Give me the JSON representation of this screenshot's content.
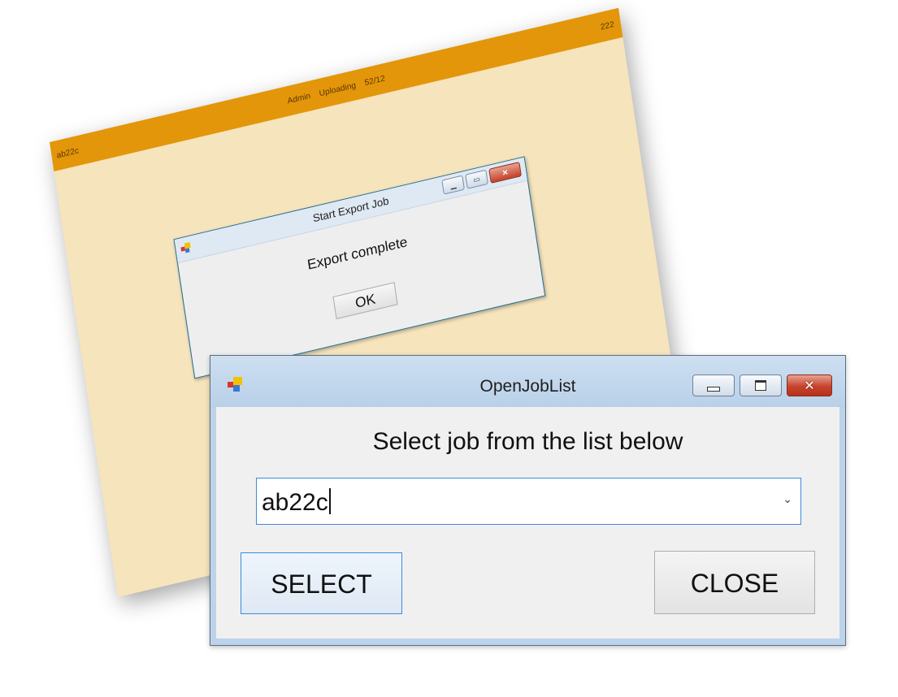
{
  "background_window": {
    "topbar": {
      "left_text": "ab22c",
      "center_items": [
        "Admin",
        "Uploading",
        "52/12"
      ],
      "right_text": "222"
    },
    "dialog": {
      "title": "Start Export Job",
      "message": "Export complete",
      "ok_label": "OK"
    }
  },
  "open_job_list": {
    "title": "OpenJobList",
    "heading": "Select job from the list below",
    "job_combo": {
      "value": "ab22c"
    },
    "select_label": "SELECT",
    "close_label": "CLOSE",
    "window_controls": {
      "close_glyph": "✕"
    }
  },
  "colors": {
    "app_background": "#f6e4bd",
    "app_topbar": "#e3960a",
    "focus_border": "#3c8ae0",
    "close_button": "#c5432d"
  }
}
